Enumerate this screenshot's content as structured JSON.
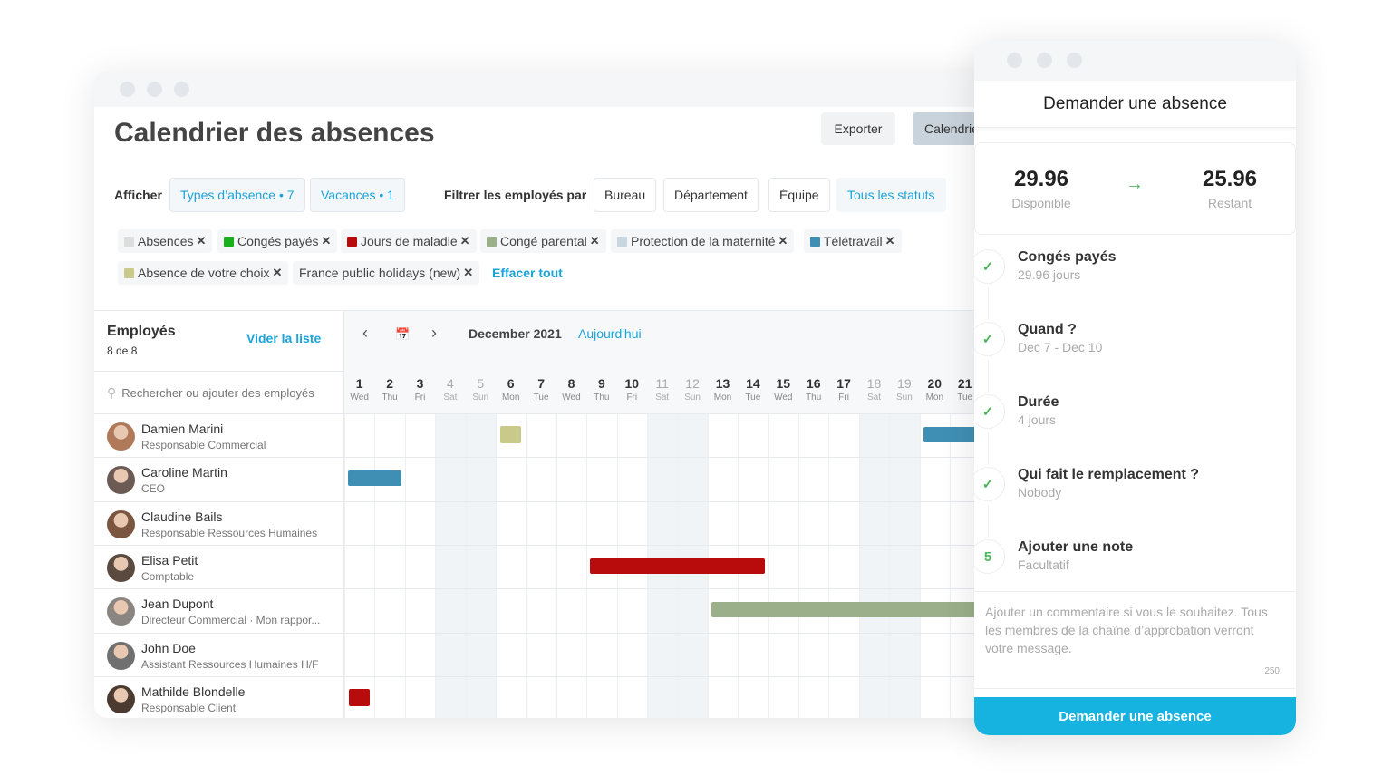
{
  "main": {
    "title": "Calendrier des absences",
    "export_label": "Exporter",
    "calendar_label": "Calendrier",
    "show_label": "Afficher",
    "filters_left": [
      "Types d’absence • 7",
      "Vacances • 1"
    ],
    "filter_by_label": "Filtrer les employés par",
    "filters_right": [
      {
        "label": "Bureau",
        "active": false
      },
      {
        "label": "Département",
        "active": false
      },
      {
        "label": "Équipe",
        "active": false
      },
      {
        "label": "Tous les statuts",
        "active": true
      }
    ],
    "chips": [
      {
        "label": "Absences",
        "color": "#dddddd"
      },
      {
        "label": "Congés payés",
        "color": "#17b21a"
      },
      {
        "label": "Jours de maladie",
        "color": "#b80b0b"
      },
      {
        "label": "Congé parental",
        "color": "#9bb08a"
      },
      {
        "label": "Protection de la maternité",
        "color": "#c8d6e2"
      },
      {
        "label": "Télétravail",
        "color": "#3f8fb4"
      },
      {
        "label": "Absence de votre choix",
        "color": "#c9c98a"
      },
      {
        "label": "France public holidays (new)",
        "color": ""
      }
    ],
    "clear_all": "Effacer tout"
  },
  "employees_panel": {
    "title": "Employés",
    "count": "8 de 8",
    "clear_list": "Vider la liste",
    "search_placeholder": "Rechercher ou ajouter des employés"
  },
  "calendar": {
    "month": "December 2021",
    "today": "Aujourd'hui",
    "days": [
      [
        "1",
        "Wed"
      ],
      [
        "2",
        "Thu"
      ],
      [
        "3",
        "Fri"
      ],
      [
        "4",
        "Sat"
      ],
      [
        "5",
        "Sun"
      ],
      [
        "6",
        "Mon"
      ],
      [
        "7",
        "Tue"
      ],
      [
        "8",
        "Wed"
      ],
      [
        "9",
        "Thu"
      ],
      [
        "10",
        "Fri"
      ],
      [
        "11",
        "Sat"
      ],
      [
        "12",
        "Sun"
      ],
      [
        "13",
        "Mon"
      ],
      [
        "14",
        "Tue"
      ],
      [
        "15",
        "Wed"
      ],
      [
        "16",
        "Thu"
      ],
      [
        "17",
        "Fri"
      ],
      [
        "18",
        "Sat"
      ],
      [
        "19",
        "Sun"
      ],
      [
        "20",
        "Mon"
      ],
      [
        "21",
        "Tue"
      ]
    ]
  },
  "employees": [
    {
      "name": "Damien Marini",
      "role": "Responsable Commercial",
      "avatar": "#b07a5a"
    },
    {
      "name": "Caroline Martin",
      "role": "CEO",
      "avatar": "#6b5b54"
    },
    {
      "name": "Claudine Bails",
      "role": "Responsable Ressources Humaines",
      "avatar": "#7a5540"
    },
    {
      "name": "Elisa Petit",
      "role": "Comptable",
      "avatar": "#5a4a40"
    },
    {
      "name": "Jean Dupont",
      "role": "Directeur Commercial · Mon rappor...",
      "avatar": "#8a8580"
    },
    {
      "name": "John Doe",
      "role": "Assistant Ressources Humaines H/F",
      "avatar": "#707070"
    },
    {
      "name": "Mathilde Blondelle",
      "role": "Responsable Client",
      "avatar": "#4a3a30"
    }
  ],
  "absences": [
    {
      "employee": 0,
      "start": 6,
      "end": 6,
      "type": "Absence de votre choix",
      "color": "#c9c98a"
    },
    {
      "employee": 0,
      "start": 20,
      "end": 22,
      "type": "Télétravail",
      "color": "#3f8fb4"
    },
    {
      "employee": 1,
      "start": 1,
      "end": 2,
      "type": "Télétravail",
      "color": "#3f8fb4"
    },
    {
      "employee": 3,
      "start": 9,
      "end": 14,
      "type": "Jours de maladie",
      "color": "#b80b0b"
    },
    {
      "employee": 4,
      "start": 13,
      "end": 22,
      "type": "Congé parental",
      "color": "#9bb08a"
    },
    {
      "employee": 6,
      "start": 1,
      "end": 1,
      "type": "Jours de maladie",
      "color": "#b80b0b"
    }
  ],
  "request": {
    "title": "Demander une absence",
    "available_value": "29.96",
    "available_label": "Disponible",
    "remaining_value": "25.96",
    "remaining_label": "Restant",
    "steps": [
      {
        "marker": "✓",
        "title": "Congés payés",
        "sub": "29.96 jours"
      },
      {
        "marker": "✓",
        "title": "Quand ?",
        "sub": "Dec 7 - Dec 10"
      },
      {
        "marker": "✓",
        "title": "Durée",
        "sub": "4 jours"
      },
      {
        "marker": "✓",
        "title": "Qui fait le remplacement ?",
        "sub": "Nobody"
      },
      {
        "marker": "5",
        "title": "Ajouter une note",
        "sub": "Facultatif"
      }
    ],
    "note_placeholder": "Ajouter un commentaire si vous le souhaitez. Tous les membres de la chaîne d’approbation verront votre message.",
    "char_count": "250",
    "submit_label": "Demander une absence"
  }
}
